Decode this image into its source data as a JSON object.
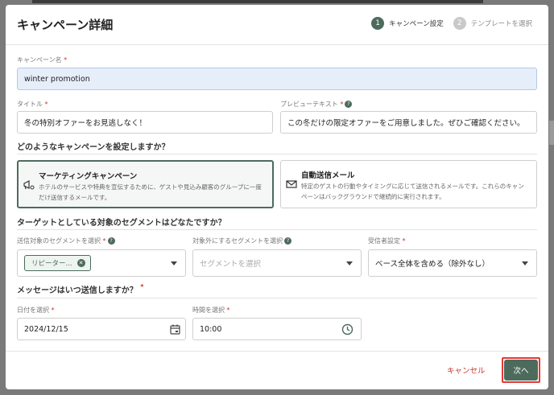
{
  "header": {
    "title": "キャンペーン詳細",
    "steps": [
      {
        "num": "1",
        "label": "キャンペーン設定"
      },
      {
        "num": "2",
        "label": "テンプレートを選択"
      }
    ]
  },
  "campaign_name": {
    "label": "キャンペーン名",
    "required": "*",
    "value": "winter promotion"
  },
  "title_field": {
    "label": "タイトル",
    "required": "*",
    "value": "冬の特別オファーをお見逃しなく！"
  },
  "preview_field": {
    "label": "プレビューテキスト",
    "required": "*",
    "help": "?",
    "value": "この冬だけの限定オファーをご用意しました。ぜひご確認ください。"
  },
  "campaign_type": {
    "question": "どのようなキャンペーンを設定しますか？",
    "options": [
      {
        "title": "マーケティングキャンペーン",
        "desc": "ホテルのサービスや特典を宣伝するために、ゲストや見込み顧客のグループに一度だけ送信するメールです。"
      },
      {
        "title": "自動送信メール",
        "desc": "特定のゲストの行動やタイミングに応じて送信されるメールです。これらのキャンペーンはバックグラウンドで継続的に実行されます。"
      }
    ]
  },
  "segments": {
    "question": "ターゲットとしている対象のセグメントはどなたですか？",
    "include": {
      "label": "送信対象のセグメントを選択",
      "required": "*",
      "help": "?",
      "chip": "リピーター..."
    },
    "exclude": {
      "label": "対象外にするセグメントを選択",
      "help": "?",
      "placeholder": "セグメントを選択"
    },
    "recipients": {
      "label": "受信者設定",
      "required": "*",
      "value": "ベース全体を含める（除外なし）"
    }
  },
  "schedule": {
    "question": "メッセージはいつ送信しますか？",
    "required": "*",
    "date": {
      "label": "日付を選択",
      "required": "*",
      "value": "2024/12/15"
    },
    "time": {
      "label": "時間を選択",
      "required": "*",
      "value": "10:00"
    }
  },
  "footer": {
    "cancel": "キャンセル",
    "next": "次へ"
  },
  "colors": {
    "accent": "#4d6b5c",
    "danger": "#c0392b",
    "highlight": "#e53935"
  }
}
